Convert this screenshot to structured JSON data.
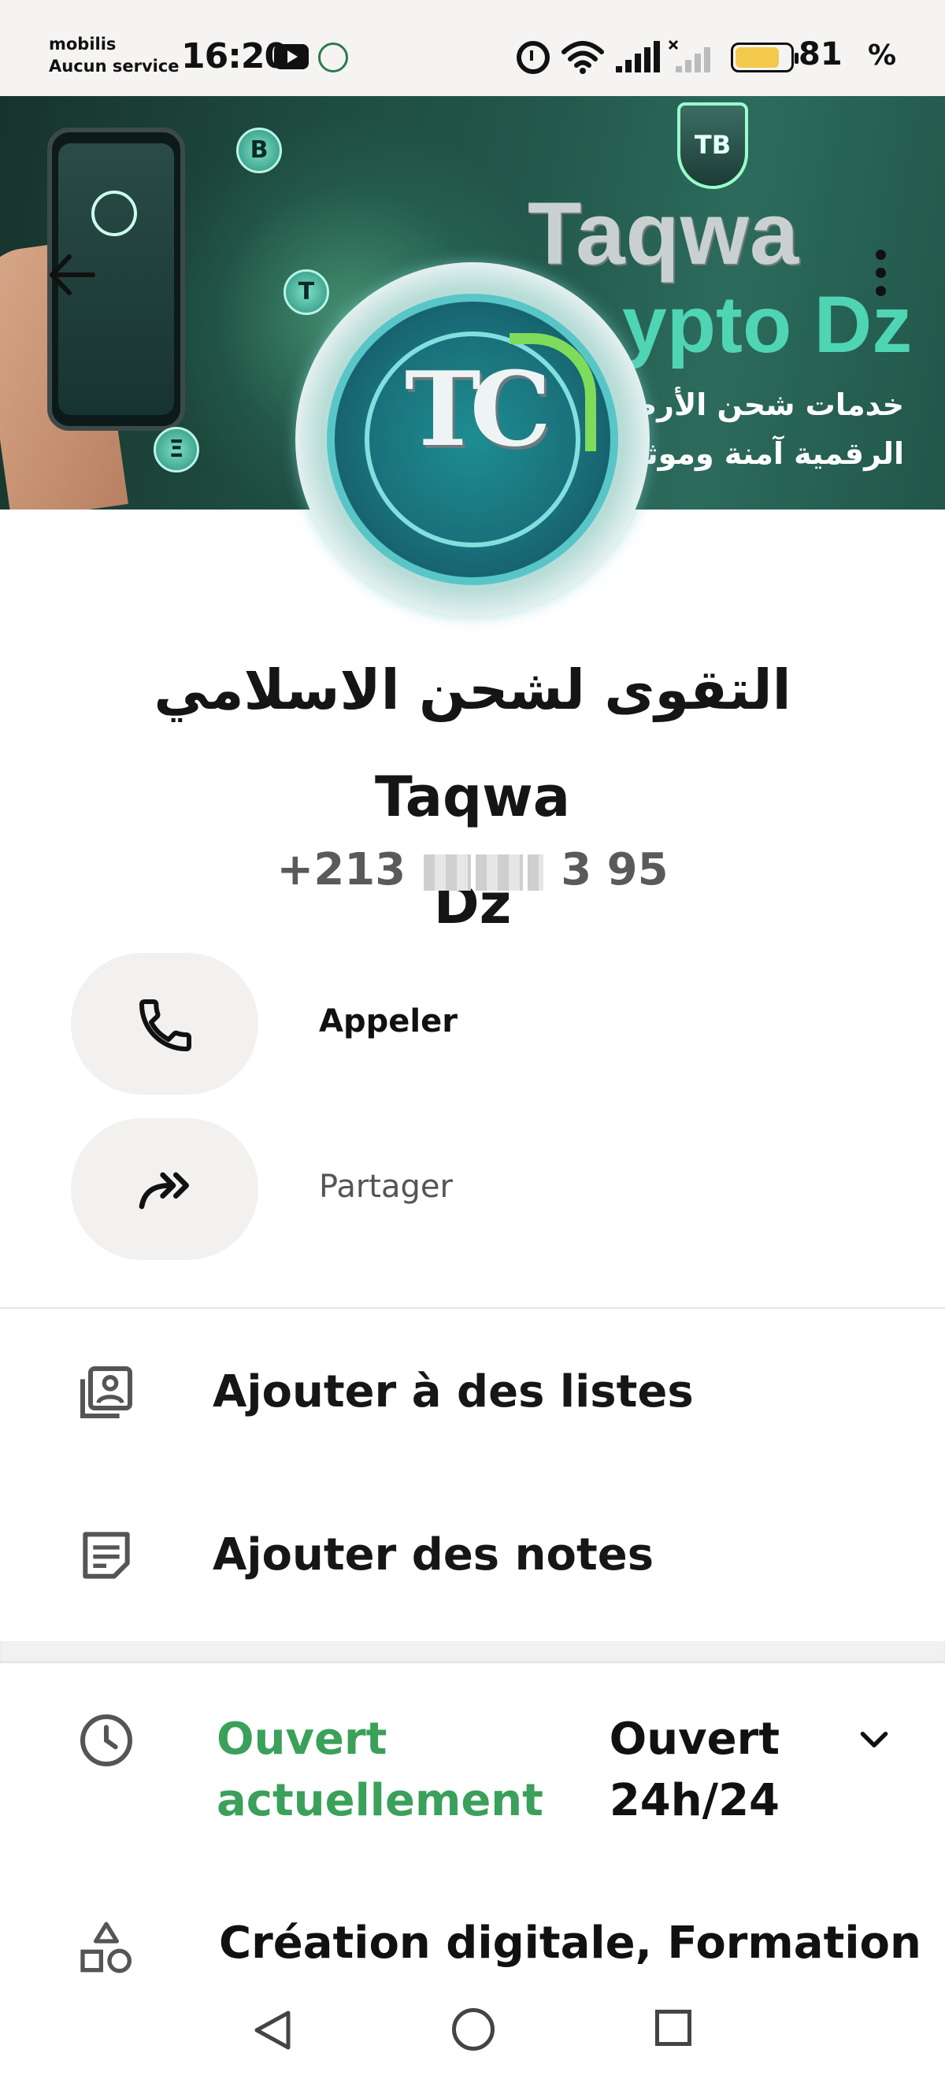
{
  "status_bar": {
    "carrier_name": "mobilis",
    "carrier_status": "Aucun service",
    "time": "16:20",
    "battery_level": "81",
    "battery_unit": "%",
    "icons": [
      "youtube-icon",
      "app-icon",
      "alarm-icon",
      "wifi-icon",
      "signal-icon",
      "signal-no-service-icon",
      "battery-icon"
    ]
  },
  "banner": {
    "title": "Taqwa",
    "subtitle": "ypto Dz",
    "arabic_line1": "خدمات شحن الأرصدة",
    "arabic_line2": "الرقمية آمنة وموثو",
    "shield_text": "TB",
    "coin_labels": [
      "B",
      "T",
      "Ξ"
    ]
  },
  "profile_logo": {
    "text": "TC",
    "accent_color": "#7fdc5a"
  },
  "business": {
    "name_line1": "التقوى لشحن الاسلامي Taqwa",
    "name_line2": "Dz",
    "phone_prefix": "+213",
    "phone_suffix": "3 95"
  },
  "actions": [
    {
      "label": "Appeler",
      "icon": "phone-icon"
    },
    {
      "label": "Partager",
      "icon": "share-icon"
    }
  ],
  "menu": [
    {
      "label": "Ajouter à des listes",
      "icon": "add-to-list-icon"
    },
    {
      "label": "Ajouter des notes",
      "icon": "notes-icon"
    }
  ],
  "hours": {
    "status": "Ouvert actuellement",
    "value": "Ouvert 24h/24",
    "status_color": "#3aa05a"
  },
  "category": {
    "text": "Création digitale, Formation"
  },
  "nav": {
    "icons": [
      "back-nav-icon",
      "home-nav-icon",
      "recents-nav-icon"
    ]
  }
}
